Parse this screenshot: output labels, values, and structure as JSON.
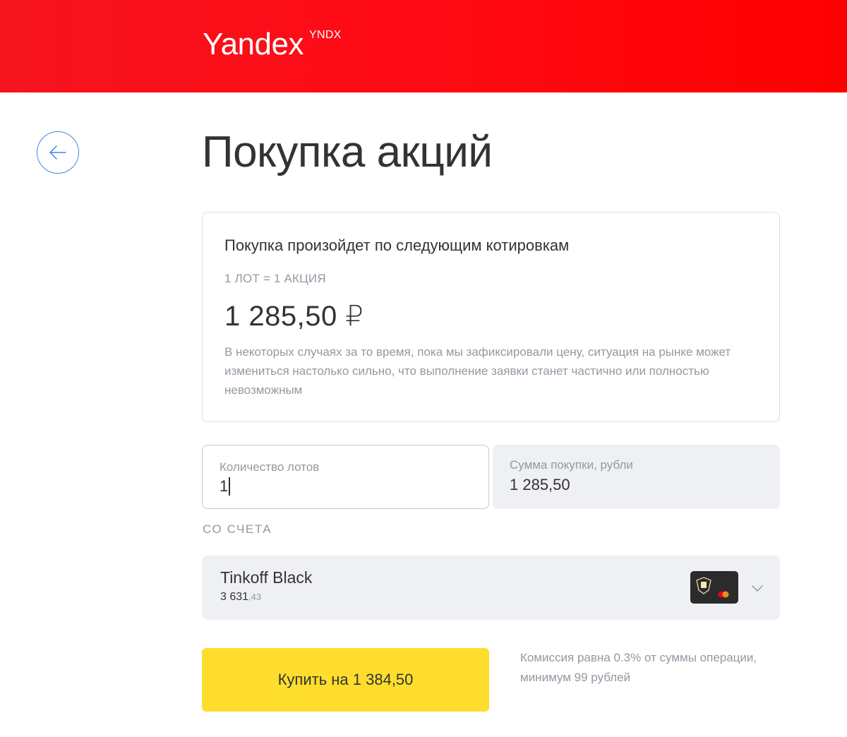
{
  "header": {
    "brand": "Yandex",
    "ticker": "YNDX"
  },
  "page": {
    "title": "Покупка акций"
  },
  "quote": {
    "heading": "Покупка произойдет по следующим котировкам",
    "lot_note": "1 ЛОТ = 1 АКЦИЯ",
    "price": "1 285,50 ₽",
    "disclaimer": "В некоторых случаях за то время, пока мы зафиксировали цену, ситуация на рынке может измениться настолько сильно, что выполнение заявки станет частично или полностью невозможным"
  },
  "order": {
    "quantity_label": "Количество лотов",
    "quantity_value": "1",
    "sum_label": "Сумма покупки, рубли",
    "sum_value": "1 285,50"
  },
  "account": {
    "section_label": "СО СЧЕТА",
    "name": "Tinkoff Black",
    "balance_whole": "3 631",
    "balance_fraction": ",43"
  },
  "actions": {
    "buy_label": "Купить на 1 384,50",
    "commission_note": "Комиссия равна 0.3% от суммы операции, минимум 99 рублей"
  },
  "icons": {
    "back": "arrow-left-icon",
    "card": "card-logo-icon",
    "dropdown": "chevron-down-icon"
  },
  "colors": {
    "header_red": "#ff0a14",
    "accent_blue": "#3f8ae0",
    "buy_yellow": "#ffdd2d",
    "muted_text": "#9299a2",
    "field_bg": "#eef0f4"
  }
}
